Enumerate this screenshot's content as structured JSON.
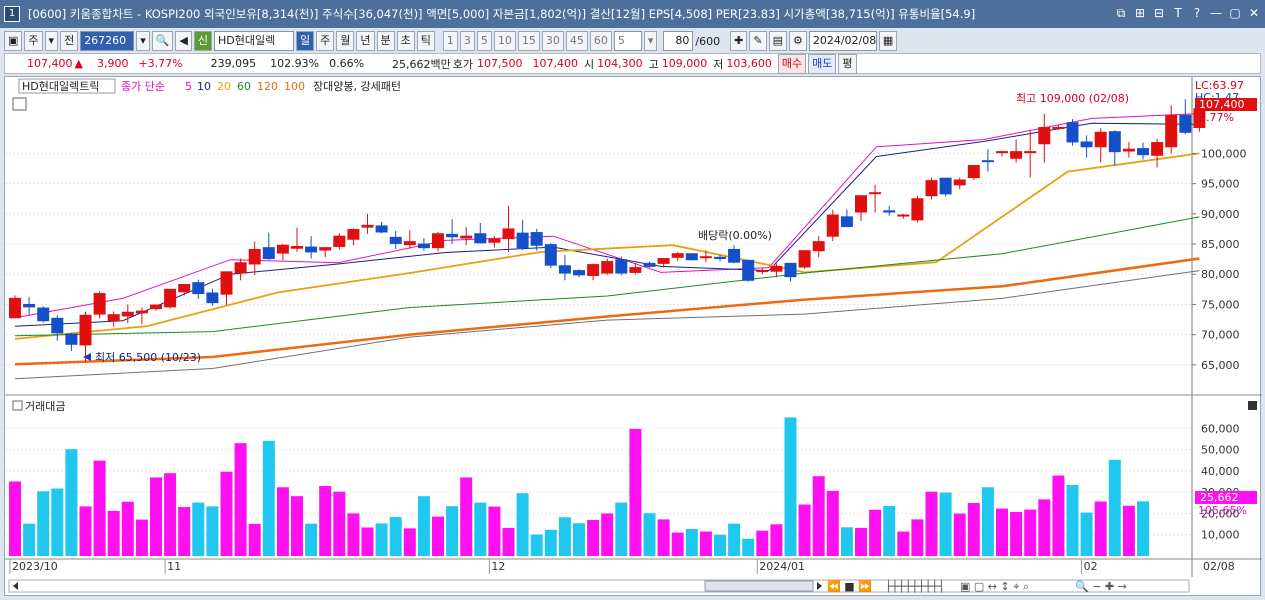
{
  "window": {
    "title": "[0600] 키움종합차트 - KOSPI200 외국인보유[8,314(천)] 주식수[36,047(천)] 액면[5,000] 자본금[1,802(억)] 결산[12월] EPS[4,508] PER[23.83] 시가총액[38,715(억)] 유통비율[54.9]",
    "icon_label": "1",
    "buttons": [
      "⧉",
      "⊞",
      "⊟",
      "T",
      "?",
      "—",
      "▢",
      "✕"
    ]
  },
  "toolbar": {
    "type_week": "주",
    "type_prev": "전",
    "stock_code": "267260",
    "stock_name": "HD현대일렉",
    "period_tabs": [
      "일",
      "주",
      "월",
      "년",
      "분",
      "초",
      "틱"
    ],
    "minute_tabs": [
      "1",
      "3",
      "5",
      "10",
      "15",
      "30",
      "45",
      "60"
    ],
    "min_value": "5",
    "count_value": "80",
    "count_total": "/600",
    "date": "2024/02/08"
  },
  "quote": {
    "price": "107,400",
    "arrow": "▲",
    "change": "3,900",
    "change_pct": "+3.77%",
    "volume": "239,095",
    "vol_ratio": "102.93%",
    "turnover": "0.66%",
    "amount": "25,662백만",
    "hoga_label": "호가",
    "ask": "107,500",
    "bid": "107,400",
    "open_label": "시",
    "open": "104,300",
    "high_label": "고",
    "high": "109,000",
    "low_label": "저",
    "low": "103,600",
    "sell": "매수",
    "buy": "매도",
    "avg": "평"
  },
  "chart": {
    "legend_name": "HD현대일렉트릭",
    "legend_series": "종가 단순",
    "ma_periods": [
      "5",
      "10",
      "20",
      "60",
      "120",
      "100"
    ],
    "pattern": "장대양봉, 강세패턴",
    "high_note": "최고 109,000 (02/08)",
    "low_note": "최저 65,500 (10/23)",
    "dividend_note": "배당락(0.00%)",
    "lc_label": "LC:63.97",
    "hc_label": "HC:1.47",
    "last_price": "107,400",
    "last_pct": "3.77%",
    "price_axis": [
      "100,000",
      "95,000",
      "90,000",
      "85,000",
      "80,000",
      "75,000",
      "70,000",
      "65,000"
    ],
    "volume_title": "거래대금",
    "volume_axis": [
      "60,000",
      "50,000",
      "40,000",
      "30,000",
      "20,000",
      "10,000"
    ],
    "vol_last": "25,662",
    "vol_last_pct": "105.65%",
    "x_labels": [
      "2023/10",
      "11",
      "12",
      "2024/01",
      "02",
      "02/08"
    ]
  },
  "chart_data": {
    "type": "candlestick",
    "ylim": [
      61000,
      111000
    ],
    "candles": [
      [
        72800,
        76500,
        74400,
        76000
      ],
      [
        75000,
        76200,
        73300,
        74600
      ],
      [
        74400,
        74700,
        72000,
        72300
      ],
      [
        72700,
        73200,
        69000,
        70300
      ],
      [
        70100,
        70300,
        67300,
        68400
      ],
      [
        68300,
        73800,
        65500,
        73200
      ],
      [
        73400,
        77200,
        72700,
        76800
      ],
      [
        72300,
        73800,
        71300,
        73300
      ],
      [
        73100,
        75000,
        71900,
        73700
      ],
      [
        73600,
        74500,
        71700,
        73900
      ],
      [
        74300,
        75000,
        74000,
        74900
      ],
      [
        74600,
        77600,
        74300,
        77500
      ],
      [
        77100,
        78300,
        76500,
        78300
      ],
      [
        78600,
        79100,
        75900,
        76800
      ],
      [
        76900,
        77600,
        74800,
        75300
      ],
      [
        76700,
        80400,
        74900,
        80400
      ],
      [
        80200,
        82600,
        79000,
        81900
      ],
      [
        81700,
        85400,
        79900,
        84100
      ],
      [
        84400,
        86900,
        82400,
        82600
      ],
      [
        83500,
        85000,
        82300,
        84800
      ],
      [
        84300,
        87700,
        83700,
        84600
      ],
      [
        84500,
        86300,
        82600,
        83700
      ],
      [
        84000,
        84500,
        82800,
        84400
      ],
      [
        84600,
        86800,
        84100,
        86300
      ],
      [
        85800,
        87600,
        84800,
        87400
      ],
      [
        87800,
        90000,
        86700,
        88100
      ],
      [
        88000,
        88700,
        86800,
        87000
      ],
      [
        86100,
        87200,
        84200,
        85100
      ],
      [
        84900,
        87300,
        84200,
        85400
      ],
      [
        85000,
        86000,
        83900,
        84400
      ],
      [
        84400,
        87000,
        83800,
        86700
      ],
      [
        86600,
        89100,
        85000,
        86200
      ],
      [
        86000,
        87800,
        84800,
        86300
      ],
      [
        86700,
        88500,
        85100,
        85200
      ],
      [
        85300,
        86300,
        84400,
        85800
      ],
      [
        85900,
        91300,
        83700,
        87500
      ],
      [
        86800,
        89000,
        84000,
        84400
      ],
      [
        86900,
        87500,
        83900,
        84800
      ],
      [
        84900,
        85200,
        81000,
        81500
      ],
      [
        81400,
        83200,
        79000,
        80200
      ],
      [
        80600,
        80800,
        79500,
        79900
      ],
      [
        79800,
        81800,
        79000,
        81600
      ],
      [
        80200,
        82600,
        79900,
        82100
      ],
      [
        82400,
        82900,
        79800,
        80200
      ],
      [
        80300,
        81900,
        80000,
        81100
      ],
      [
        81800,
        82100,
        81100,
        81300
      ],
      [
        81800,
        82600,
        81100,
        82600
      ],
      [
        82800,
        83700,
        82200,
        83400
      ],
      [
        83400,
        83400,
        82300,
        82400
      ],
      [
        82900,
        84000,
        82000,
        82900
      ],
      [
        82800,
        83200,
        82100,
        82600
      ],
      [
        84100,
        84800,
        81800,
        82000
      ],
      [
        82300,
        82400,
        78800,
        79000
      ],
      [
        80600,
        81000,
        80000,
        80600
      ],
      [
        80500,
        81800,
        79500,
        81300
      ],
      [
        81800,
        81800,
        78800,
        79600
      ],
      [
        81200,
        84000,
        80900,
        83900
      ],
      [
        83900,
        86300,
        82800,
        85400
      ],
      [
        86300,
        90700,
        85500,
        89800
      ],
      [
        89500,
        90700,
        87800,
        87900
      ],
      [
        90300,
        93000,
        88800,
        93000
      ],
      [
        93400,
        94800,
        90200,
        93500
      ],
      [
        90500,
        91300,
        89700,
        90300
      ],
      [
        89800,
        90000,
        89200,
        89800
      ],
      [
        89000,
        93000,
        88600,
        92500
      ],
      [
        93000,
        96000,
        92400,
        95500
      ],
      [
        95900,
        95900,
        92900,
        93300
      ],
      [
        94800,
        96000,
        94100,
        95600
      ],
      [
        96000,
        98000,
        95600,
        98000
      ],
      [
        98800,
        100700,
        97000,
        98700
      ],
      [
        100300,
        100300,
        99500,
        100300
      ],
      [
        99200,
        102300,
        98500,
        100300
      ],
      [
        100300,
        103700,
        96000,
        100300
      ],
      [
        101600,
        106600,
        98500,
        104300
      ],
      [
        104300,
        104700,
        103900,
        104300
      ],
      [
        105100,
        105700,
        101300,
        101900
      ],
      [
        101900,
        103000,
        99300,
        101100
      ],
      [
        101100,
        104200,
        98500,
        103500
      ],
      [
        103600,
        103800,
        98000,
        100300
      ],
      [
        100400,
        101900,
        99300,
        100700
      ],
      [
        100800,
        101800,
        99000,
        99800
      ],
      [
        99700,
        102400,
        97700,
        101800
      ],
      [
        101100,
        108000,
        100000,
        106300
      ],
      [
        106300,
        109000,
        103200,
        103500
      ],
      [
        104300,
        109000,
        103600,
        107400
      ]
    ],
    "volume_ylim": [
      0,
      70000
    ],
    "volumes": [
      35000,
      15200,
      30400,
      31700,
      50200,
      23300,
      44800,
      21200,
      25500,
      17100,
      36900,
      38900,
      23000,
      25100,
      23300,
      39600,
      53000,
      15100,
      54100,
      32300,
      28100,
      15200,
      32900,
      30200,
      20000,
      13400,
      15300,
      18300,
      13000,
      28100,
      18500,
      23400,
      36900,
      25100,
      23200,
      13200,
      29500,
      10100,
      12300,
      18200,
      15400,
      16900,
      20000,
      25100,
      59700,
      20100,
      17200,
      11000,
      12700,
      11500,
      10000,
      15200,
      8100,
      11900,
      14900,
      65100,
      24200,
      37500,
      30600,
      13500,
      13200,
      21700,
      23500,
      11500,
      17200,
      30200,
      29800,
      19900,
      24900,
      32300,
      22300,
      20700,
      21800,
      26600,
      37800,
      33400,
      20400,
      25600,
      45200,
      23600,
      25662
    ],
    "ma": {
      "5": [
        [
          72800,
          76000
        ],
        [
          82400,
          81900
        ],
        [
          85600,
          86300
        ],
        [
          80300,
          81100
        ],
        [
          101100,
          102300
        ],
        [
          105800,
          106600
        ]
      ],
      "10": [
        [
          71400,
          72300
        ],
        [
          80000,
          81700
        ],
        [
          83600,
          84500
        ],
        [
          81300,
          80600
        ],
        [
          99500,
          102000
        ],
        [
          105000,
          104800
        ]
      ],
      "20": [
        [
          69300,
          71400
        ],
        [
          77000,
          80200
        ],
        [
          83700,
          84800
        ],
        [
          80300,
          82000
        ],
        [
          97000,
          100000
        ]
      ],
      "60": [
        [
          69800,
          70500
        ],
        [
          74500,
          76400
        ],
        [
          80200,
          83400
        ],
        [
          89500
        ]
      ],
      "120": [
        [
          65100,
          66300
        ],
        [
          70000,
          73000
        ],
        [
          75800,
          78000
        ],
        [
          82600
        ]
      ],
      "100": [
        [
          62700,
          64400
        ],
        [
          69600,
          72400
        ],
        [
          73400,
          76000
        ],
        [
          80600
        ]
      ]
    }
  },
  "colors": {
    "up": "#e01010",
    "down": "#1450c8",
    "ma5": "#e010c0",
    "ma10": "#1a2080",
    "ma20": "#e8a010",
    "ma60": "#1e8a1e",
    "ma120": "#ee6a10",
    "ma100": "#707070",
    "vol_up": "#ff10f0",
    "vol_down": "#20c8f0"
  }
}
